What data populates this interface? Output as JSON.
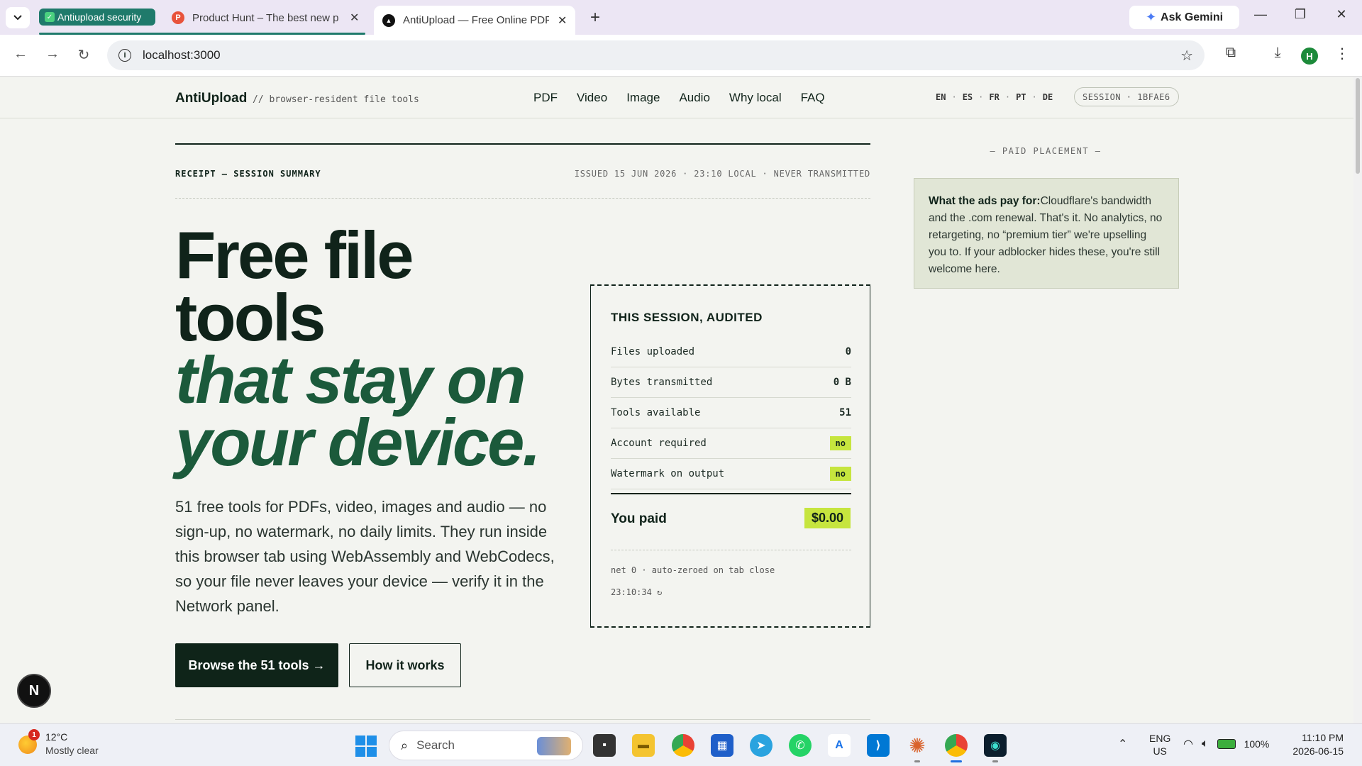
{
  "browser": {
    "tab_group": "Antiupload security",
    "tabs": [
      {
        "title": "Product Hunt – The best new p",
        "favicon": "P"
      },
      {
        "title": "AntiUpload — Free Online PDF,",
        "favicon": "▲"
      }
    ],
    "ask_gemini": "Ask Gemini",
    "url": "localhost:3000",
    "profile_initial": "H"
  },
  "site": {
    "brand": "AntiUpload",
    "tagline": "// browser-resident file tools",
    "nav": [
      "PDF",
      "Video",
      "Image",
      "Audio",
      "Why local",
      "FAQ"
    ],
    "languages": [
      "EN",
      "ES",
      "FR",
      "PT",
      "DE"
    ],
    "session": "SESSION · 1BFAE6"
  },
  "receipt": {
    "heading": "RECEIPT — SESSION SUMMARY",
    "issued": "ISSUED 15 JUN 2026 · 23:10 LOCAL · NEVER TRANSMITTED"
  },
  "hero": {
    "line1": "Free file",
    "line2": "tools",
    "line3": "that stay on",
    "line4": "your device.",
    "lead": "51 free tools for PDFs, video, images and audio — no sign-up, no watermark, no daily limits. They run inside this browser tab using WebAssembly and WebCodecs, so your file never leaves your device — verify it in the Network panel.",
    "primary_cta": "Browse the 51 tools →",
    "secondary_cta": "How it works"
  },
  "audit": {
    "title": "THIS SESSION, AUDITED",
    "rows": [
      {
        "label": "Files uploaded",
        "value": "0"
      },
      {
        "label": "Bytes transmitted",
        "value": "0 B"
      },
      {
        "label": "Tools available",
        "value": "51"
      },
      {
        "label": "Account required",
        "value": "no"
      },
      {
        "label": "Watermark on output",
        "value": "no"
      }
    ],
    "paid_label": "You paid",
    "paid_value": "$0.00",
    "footer": "net 0 · auto-zeroed on tab close",
    "time": "23:10:34 ↻"
  },
  "ad": {
    "label": "— PAID PLACEMENT —",
    "bold": "What the ads pay for:",
    "text": "Cloudflare's bandwidth and the .com renewal. That's it. No analytics, no retargeting, no “premium tier” we're upselling you to. If your adblocker hides these, you're still welcome here."
  },
  "dev_badge": "N",
  "taskbar": {
    "temp": "12°C",
    "weather": "Mostly clear",
    "weather_alerts": "1",
    "search": "Search",
    "lang": "ENG",
    "region": "US",
    "battery": "100%",
    "time": "11:10 PM",
    "date": "2026-06-15"
  },
  "colors": {
    "accent_green": "#1b5a3b",
    "lime": "#c6e53e",
    "ink": "#10231a"
  }
}
